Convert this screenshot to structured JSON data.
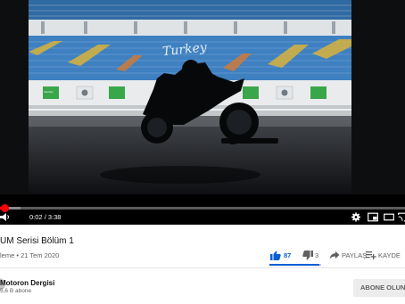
{
  "player": {
    "current_time": "0:02",
    "time_separator": " / ",
    "duration": "3:38",
    "progress_fraction": 0.01,
    "buffer_fraction": 0.05,
    "banner_text": "Turkey",
    "sponsor_text": "Intercity",
    "colors": {
      "progress": "#ff0000",
      "buffered": "#5b5b5b"
    }
  },
  "video": {
    "title": "UM Serisi Bölüm 1",
    "views": "leme",
    "bullet": " • ",
    "date": "21 Tem 2020"
  },
  "actions": {
    "like_count": "87",
    "dislike_count": "3",
    "share_label": "PAYLAŞ",
    "save_label": "KAYDE",
    "like_ratio": 0.97,
    "colors": {
      "like": "#065fd4",
      "muted": "#606060"
    }
  },
  "channel": {
    "name": "Motoron Dergisi",
    "subscribers": "5,6 B abone",
    "subscribe_label": "ABONE OLUNDU"
  }
}
